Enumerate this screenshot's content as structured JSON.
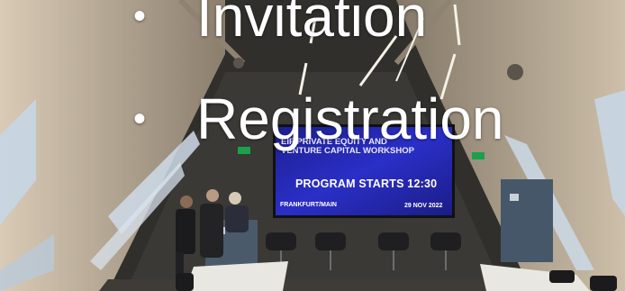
{
  "slide": {
    "bullets": [
      {
        "text": "Invitation",
        "bullet_icon": "bullet-dot"
      },
      {
        "text": "Registration",
        "bullet_icon": "bullet-dot"
      }
    ]
  },
  "screen": {
    "heading": "EIF PRIVATE EQUITY AND VENTURE CAPITAL WORKSHOP",
    "program": "PROGRAM STARTS 12:30",
    "city": "FRANKFURT/MAIN",
    "date": "29 NOV 2022"
  },
  "colors": {
    "screen_blue": "#2228b8",
    "wall_wood": "#b9a993",
    "window": "#c9d9e8"
  }
}
